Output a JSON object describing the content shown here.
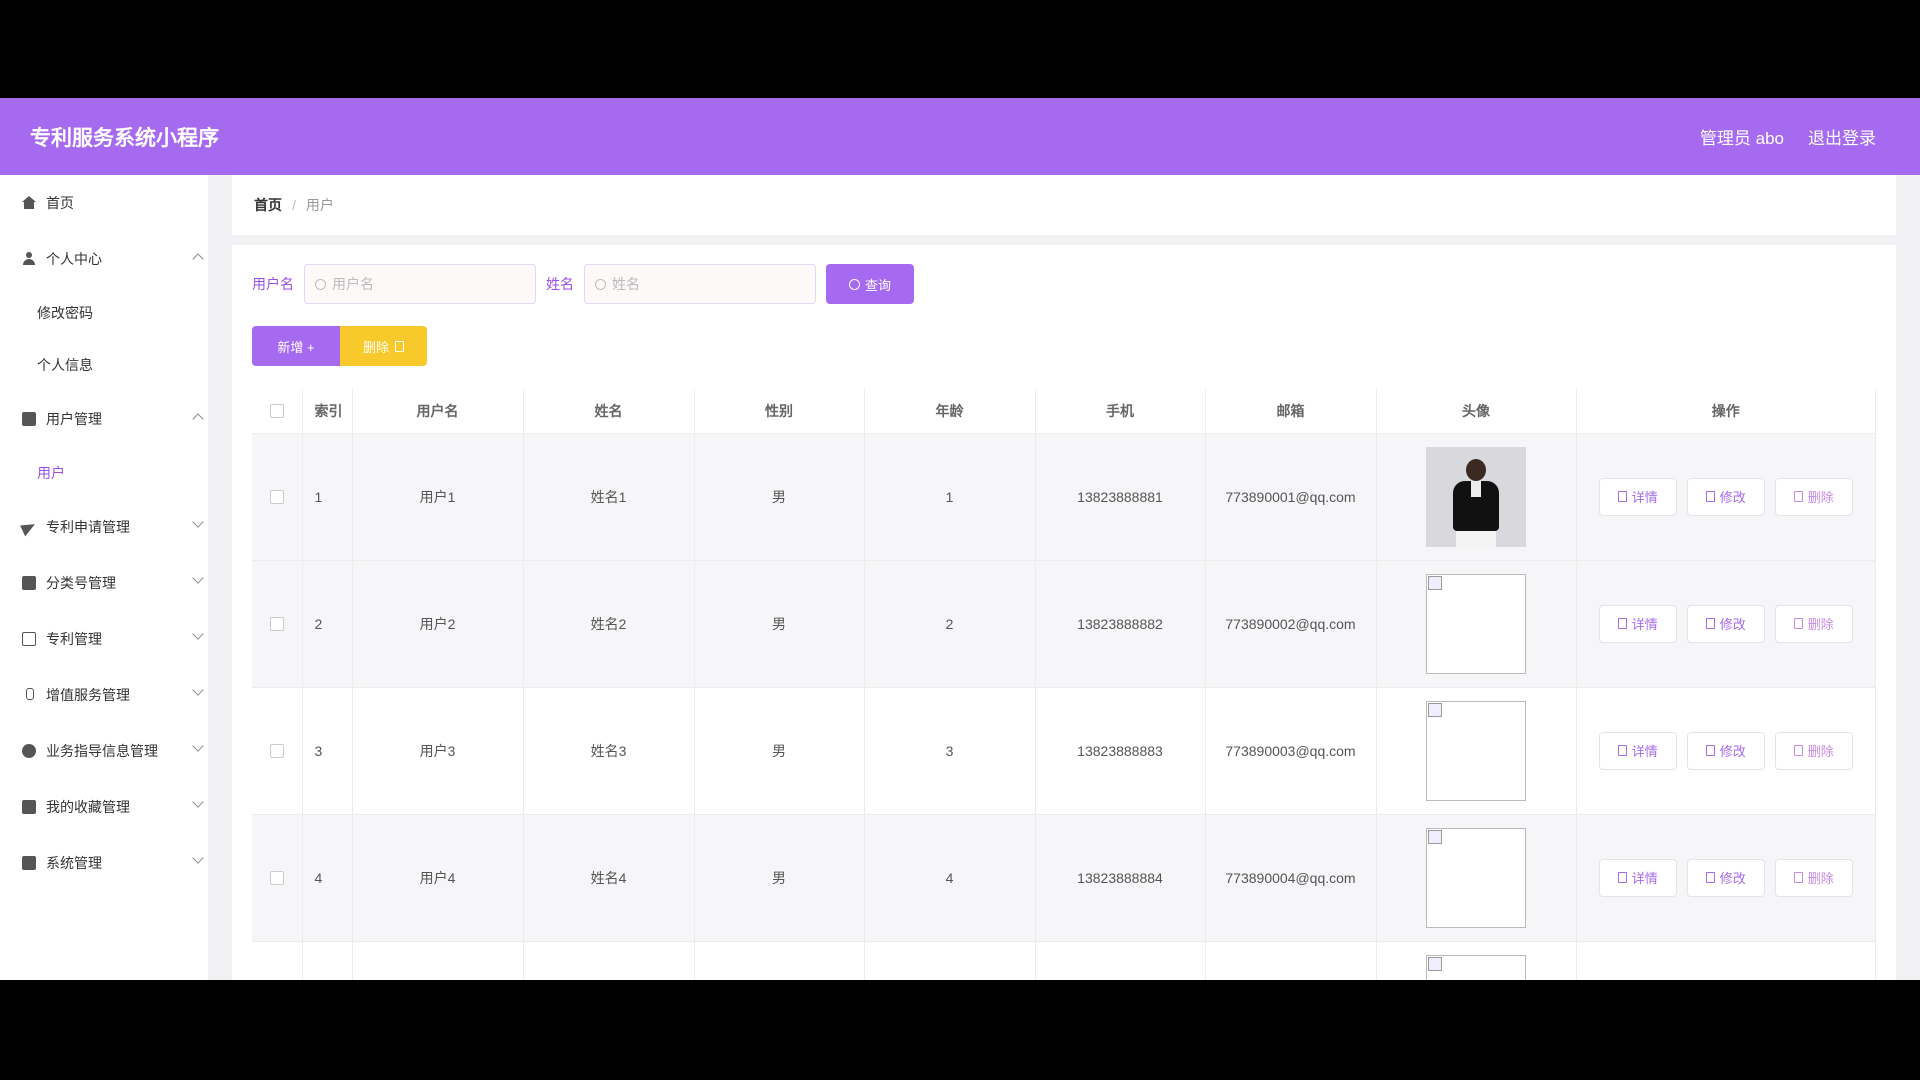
{
  "app": {
    "title": "专利服务系统小程序"
  },
  "header": {
    "admin_label": "管理员 abo",
    "logout_label": "退出登录"
  },
  "sidebar": {
    "items": [
      {
        "label": "首页",
        "icon": "home-icon"
      },
      {
        "label": "个人中心",
        "icon": "user-icon",
        "expanded": true,
        "children": [
          "修改密码",
          "个人信息"
        ]
      },
      {
        "label": "用户管理",
        "icon": "briefcase-icon",
        "expanded": true,
        "children": [
          "用户"
        ]
      },
      {
        "label": "专利申请管理",
        "icon": "send-icon"
      },
      {
        "label": "分类号管理",
        "icon": "clipboard-icon"
      },
      {
        "label": "专利管理",
        "icon": "card-icon"
      },
      {
        "label": "增值服务管理",
        "icon": "bottle-icon"
      },
      {
        "label": "业务指导信息管理",
        "icon": "globe-icon"
      },
      {
        "label": "我的收藏管理",
        "icon": "notebook-icon"
      },
      {
        "label": "系统管理",
        "icon": "toolbox-icon"
      }
    ],
    "sub": {
      "change_password": "修改密码",
      "profile": "个人信息",
      "users": "用户"
    }
  },
  "breadcrumb": {
    "home": "首页",
    "separator": "/",
    "current": "用户"
  },
  "search": {
    "username_label": "用户名",
    "username_placeholder": "用户名",
    "name_label": "姓名",
    "name_placeholder": "姓名",
    "query_label": "查询"
  },
  "actions": {
    "add_label": "新增 +",
    "delete_label": "删除"
  },
  "table": {
    "headers": [
      "索引",
      "用户名",
      "姓名",
      "性别",
      "年龄",
      "手机",
      "邮箱",
      "头像",
      "操作"
    ],
    "rows": [
      {
        "index": "1",
        "username": "用户1",
        "name": "姓名1",
        "gender": "男",
        "age": "1",
        "phone": "13823888881",
        "email": "773890001@qq.com"
      },
      {
        "index": "2",
        "username": "用户2",
        "name": "姓名2",
        "gender": "男",
        "age": "2",
        "phone": "13823888882",
        "email": "773890002@qq.com"
      },
      {
        "index": "3",
        "username": "用户3",
        "name": "姓名3",
        "gender": "男",
        "age": "3",
        "phone": "13823888883",
        "email": "773890003@qq.com"
      },
      {
        "index": "4",
        "username": "用户4",
        "name": "姓名4",
        "gender": "男",
        "age": "4",
        "phone": "13823888884",
        "email": "773890004@qq.com"
      }
    ],
    "op_labels": {
      "detail": "详情",
      "edit": "修改",
      "delete": "删除"
    }
  },
  "colors": {
    "primary": "#a66af0",
    "warning": "#f7c92a",
    "active_text": "#9b4fe8"
  }
}
